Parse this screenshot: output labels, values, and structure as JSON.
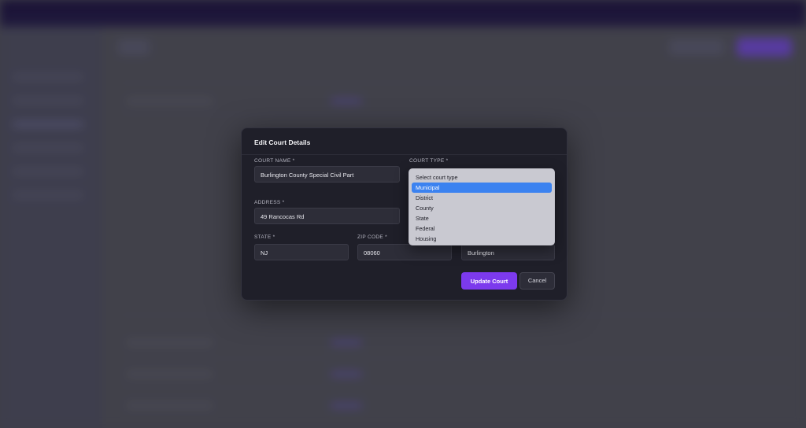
{
  "modal": {
    "title": "Edit Court Details",
    "fields": {
      "court_name": {
        "label": "COURT NAME *",
        "value": "Burlington County Special Civil Part"
      },
      "court_type": {
        "label": "COURT TYPE *"
      },
      "address": {
        "label": "ADDRESS *",
        "value": "49 Rancocas Rd"
      },
      "state": {
        "label": "STATE *",
        "value": "NJ"
      },
      "zip_code": {
        "label": "ZIP CODE *",
        "value": "08060"
      },
      "city": {
        "value": "Burlington"
      }
    },
    "buttons": {
      "update_label": "Update Court",
      "cancel_label": "Cancel"
    }
  },
  "court_type_dropdown": {
    "options": [
      "Select court type",
      "Municipal",
      "District",
      "County",
      "State",
      "Federal",
      "Housing"
    ],
    "highlighted": "Municipal"
  },
  "colors": {
    "accent": "#7c3aed",
    "highlight": "#3b82f0",
    "modal_bg": "#1f1f29"
  }
}
